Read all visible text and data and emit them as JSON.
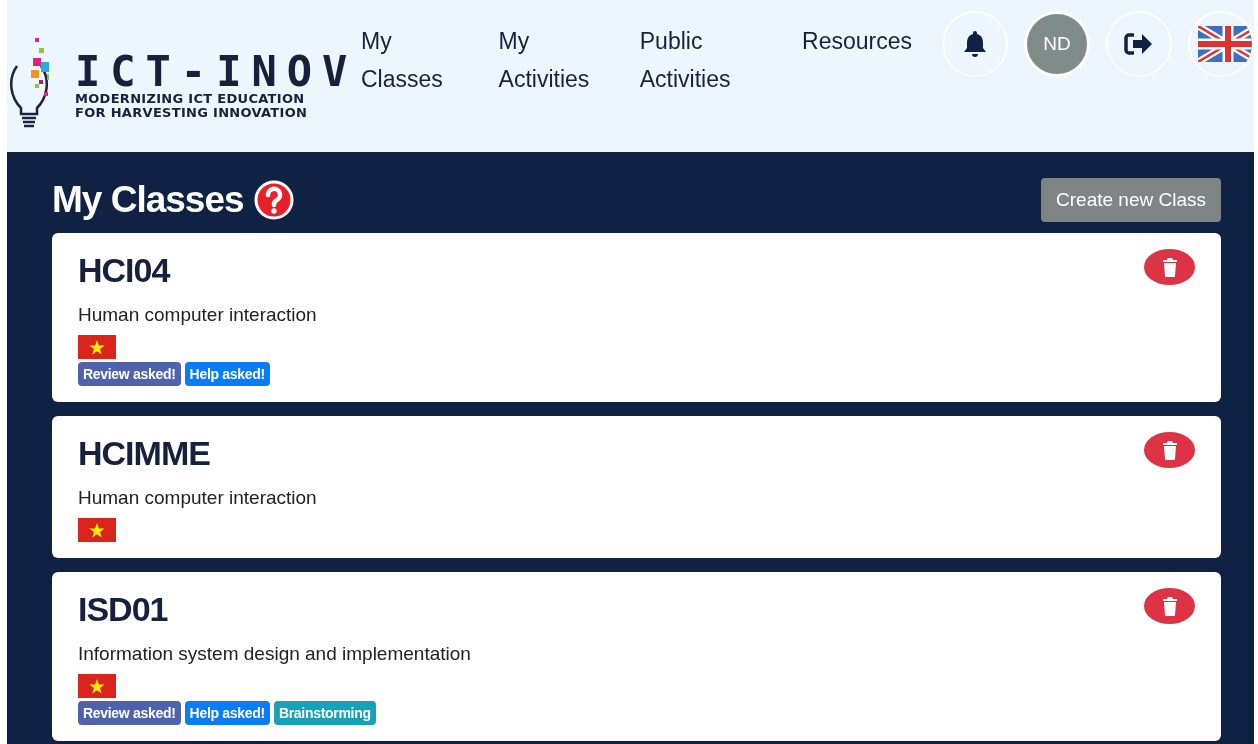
{
  "logo": {
    "name": "ICT-INOV",
    "tagline": [
      "MODERNIZING ICT EDUCATION",
      "FOR HARVESTING INNOVATION"
    ]
  },
  "nav": [
    {
      "label": "My Classes"
    },
    {
      "label": "My Activities"
    },
    {
      "label": "Public Activities"
    },
    {
      "label": "Resources"
    }
  ],
  "user": {
    "initials": "ND"
  },
  "page": {
    "title": "My Classes",
    "create_button": "Create new Class"
  },
  "classes": [
    {
      "code": "HCI04",
      "name": "Human computer interaction",
      "tags": [
        {
          "label": "Review asked!",
          "color": "#5062ac"
        },
        {
          "label": "Help asked!",
          "color": "#0a7cf7"
        }
      ]
    },
    {
      "code": "HCIMME",
      "name": "Human computer interaction"
    },
    {
      "code": "ISD01",
      "name": "Information system design and implementation",
      "tags": [
        {
          "label": "Review asked!",
          "color": "#5062ac"
        },
        {
          "label": "Help asked!",
          "color": "#0a7cf7"
        },
        {
          "label": "Brainstorming",
          "color": "#17a2b8"
        }
      ]
    }
  ]
}
